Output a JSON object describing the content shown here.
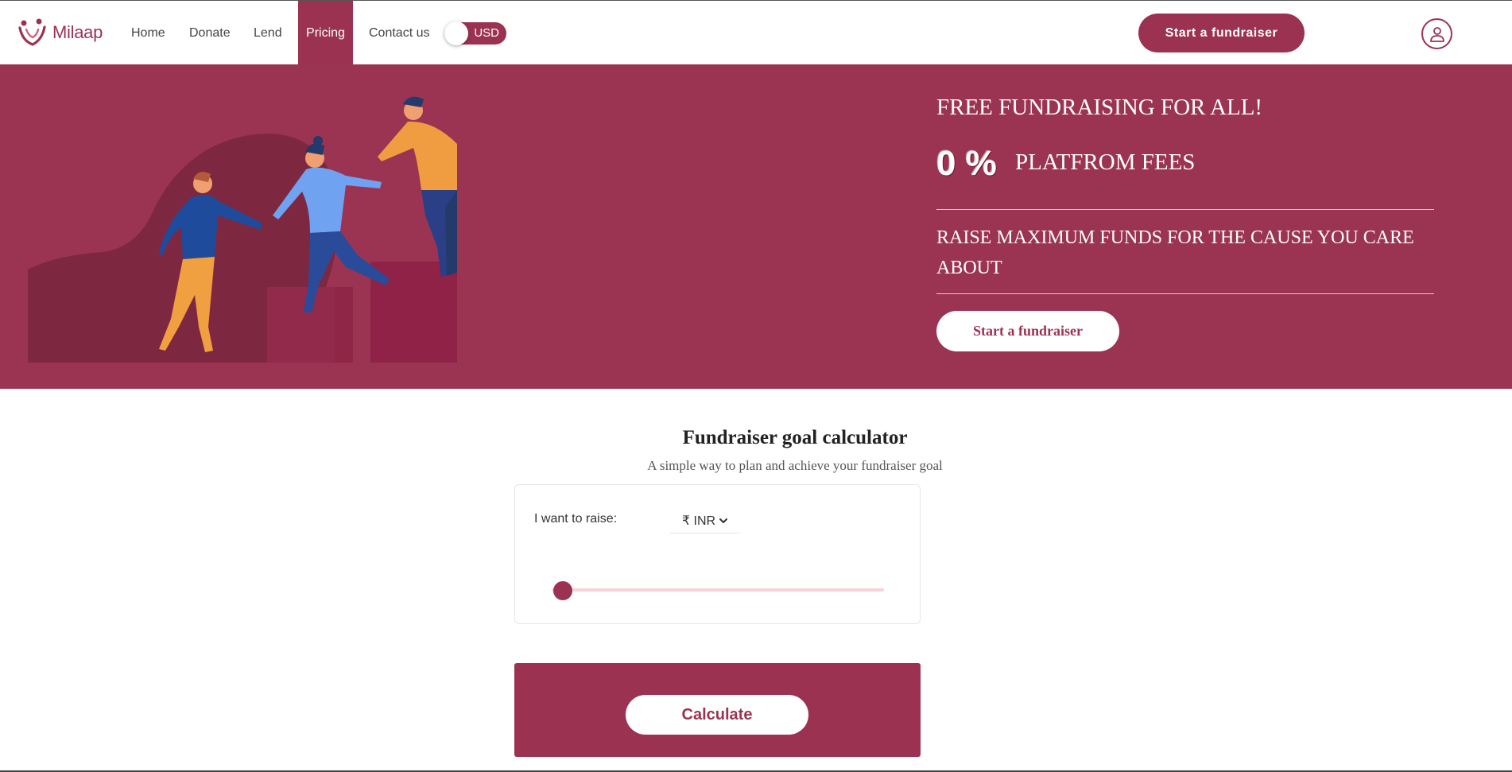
{
  "nav": {
    "brand": "Milaap",
    "links": [
      "Home",
      "Donate",
      "Lend",
      "Pricing",
      "Contact us"
    ],
    "active_link": "Pricing",
    "currency_toggle_label": "USD",
    "cta_label": "Start a fundraiser",
    "user_icon": "user-icon"
  },
  "hero": {
    "line1": "FREE FUNDRAISING FOR ALL!",
    "fee_value": "0 %",
    "fee_label": "PLATFROM FEES",
    "tagline": "RAISE MAXIMUM FUNDS FOR THE CAUSE YOU CARE ABOUT",
    "cta_label": "Start a fundraiser",
    "illustration": "people-climbing-illustration"
  },
  "calculator": {
    "title": "Fundraiser goal calculator",
    "subtitle": "A simple way to plan and achieve your fundraiser goal",
    "raise_label": "I want to raise:",
    "currency_value": "₹ INR",
    "slider_fraction": 0,
    "calculate_label": "Calculate"
  },
  "colors": {
    "brand": "#9b3252",
    "hero_bg": "#9b3453",
    "slider_track": "#f6d3d9"
  }
}
